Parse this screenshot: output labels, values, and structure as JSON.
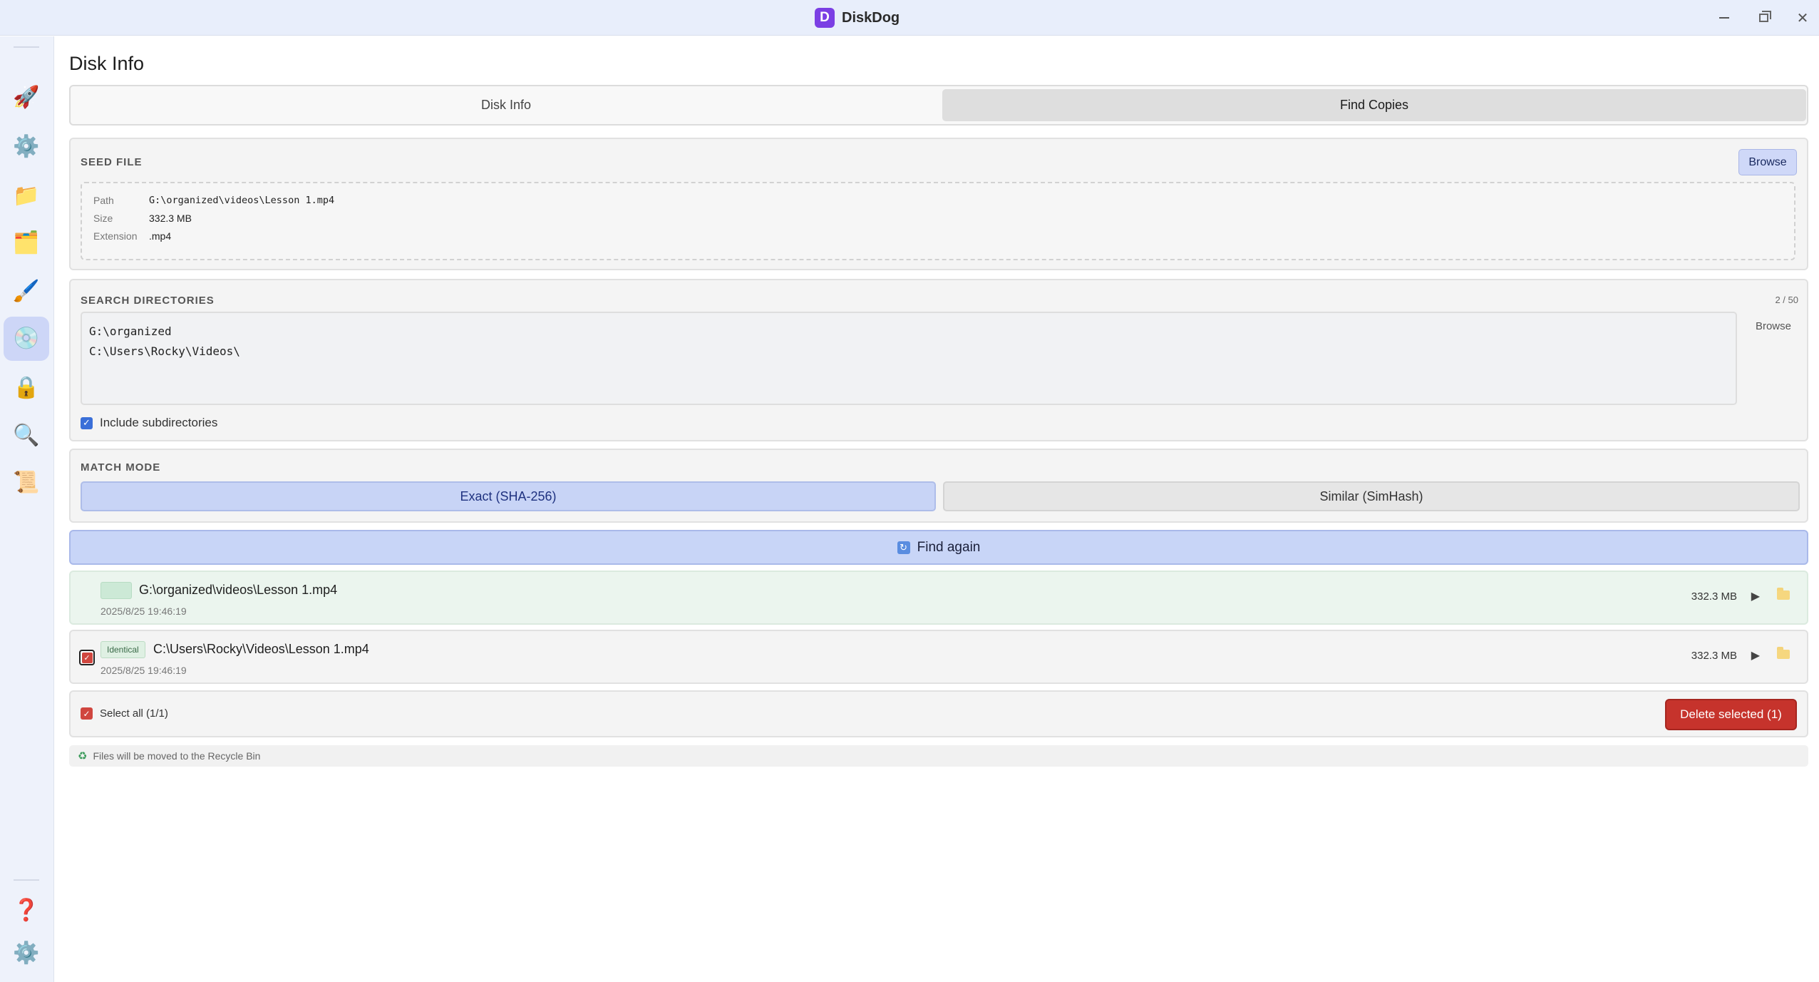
{
  "app": {
    "title": "DiskDog",
    "logo_letter": "D"
  },
  "sidebar": {
    "items": [
      {
        "id": "rocket",
        "glyph": "🚀",
        "active": false
      },
      {
        "id": "settings",
        "glyph": "⚙️",
        "active": false
      },
      {
        "id": "folder",
        "glyph": "📁",
        "active": false
      },
      {
        "id": "files",
        "glyph": "🗂️",
        "active": false
      },
      {
        "id": "clean",
        "glyph": "🖌️",
        "active": false
      },
      {
        "id": "disk",
        "glyph": "💿",
        "active": true
      },
      {
        "id": "lock",
        "glyph": "🔒",
        "active": false
      },
      {
        "id": "search",
        "glyph": "🔍",
        "active": false
      },
      {
        "id": "log",
        "glyph": "📜",
        "active": false
      }
    ],
    "bottom": [
      {
        "id": "help",
        "glyph": "❓"
      },
      {
        "id": "preferences",
        "glyph": "⚙️"
      }
    ]
  },
  "page": {
    "title": "Disk Info"
  },
  "tabs": [
    {
      "label": "Disk Info",
      "selected": false
    },
    {
      "label": "Find Copies",
      "selected": true
    }
  ],
  "seed_file": {
    "label": "SEED FILE",
    "browse_label": "Browse",
    "path_key": "Path",
    "path_value": "G:\\organized\\videos\\Lesson 1.mp4",
    "size_key": "Size",
    "size_value": "332.3 MB",
    "ext_key": "Extension",
    "ext_value": ".mp4"
  },
  "search_dirs": {
    "label": "SEARCH DIRECTORIES",
    "count": "2 / 50",
    "browse_label": "Browse",
    "dirs": [
      "G:\\organized",
      "C:\\Users\\Rocky\\Videos\\"
    ],
    "include_sub_label": "Include subdirectories",
    "include_sub_checked": true
  },
  "match_mode": {
    "label": "MATCH MODE",
    "exact_label": "Exact (SHA-256)",
    "similar_label": "Similar (SimHash)",
    "selected": "exact"
  },
  "find_again_label": "Find again",
  "results": [
    {
      "path": "G:\\organized\\videos\\Lesson 1.mp4",
      "date": "2025/8/25 19:46:19",
      "size": "332.3 MB",
      "original": true
    },
    {
      "path": "C:\\Users\\Rocky\\Videos\\Lesson 1.mp4",
      "date": "2025/8/25 19:46:19",
      "size": "332.3 MB",
      "badge": "Identical",
      "checked": true
    }
  ],
  "footer": {
    "select_all_label": "Select all (1/1)",
    "delete_label": "Delete selected (1)",
    "note": "Files will be moved to the Recycle Bin"
  },
  "colors": {
    "accent": "#c8d5f7",
    "danger": "#c6332c",
    "brand": "#7b3fe4",
    "original_row": "#ebf5ee"
  }
}
